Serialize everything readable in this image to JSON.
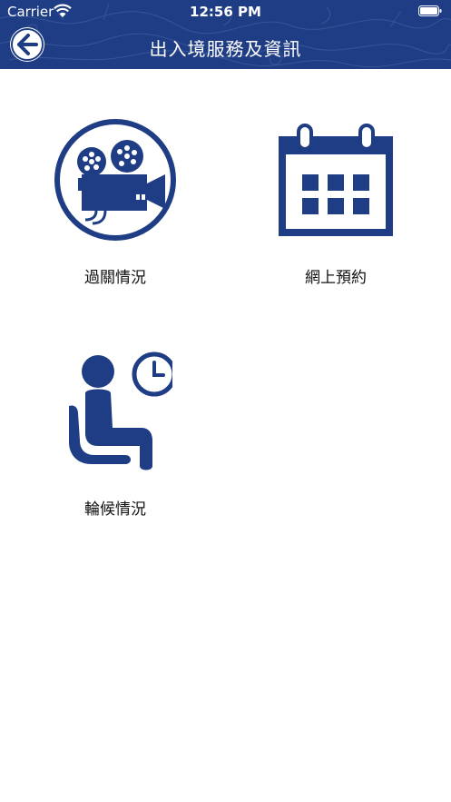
{
  "status_bar": {
    "carrier": "Carrier",
    "time": "12:56 PM"
  },
  "nav": {
    "title": "出入境服務及資訊",
    "back_icon": "back-arrow-icon"
  },
  "colors": {
    "primary": "#1f3d84",
    "background": "#ffffff",
    "text": "#111111"
  },
  "menu": {
    "items": [
      {
        "label": "過關情況",
        "icon": "video-camera-icon"
      },
      {
        "label": "網上預約",
        "icon": "calendar-icon"
      },
      {
        "label": "輪候情況",
        "icon": "waiting-person-clock-icon"
      }
    ]
  }
}
